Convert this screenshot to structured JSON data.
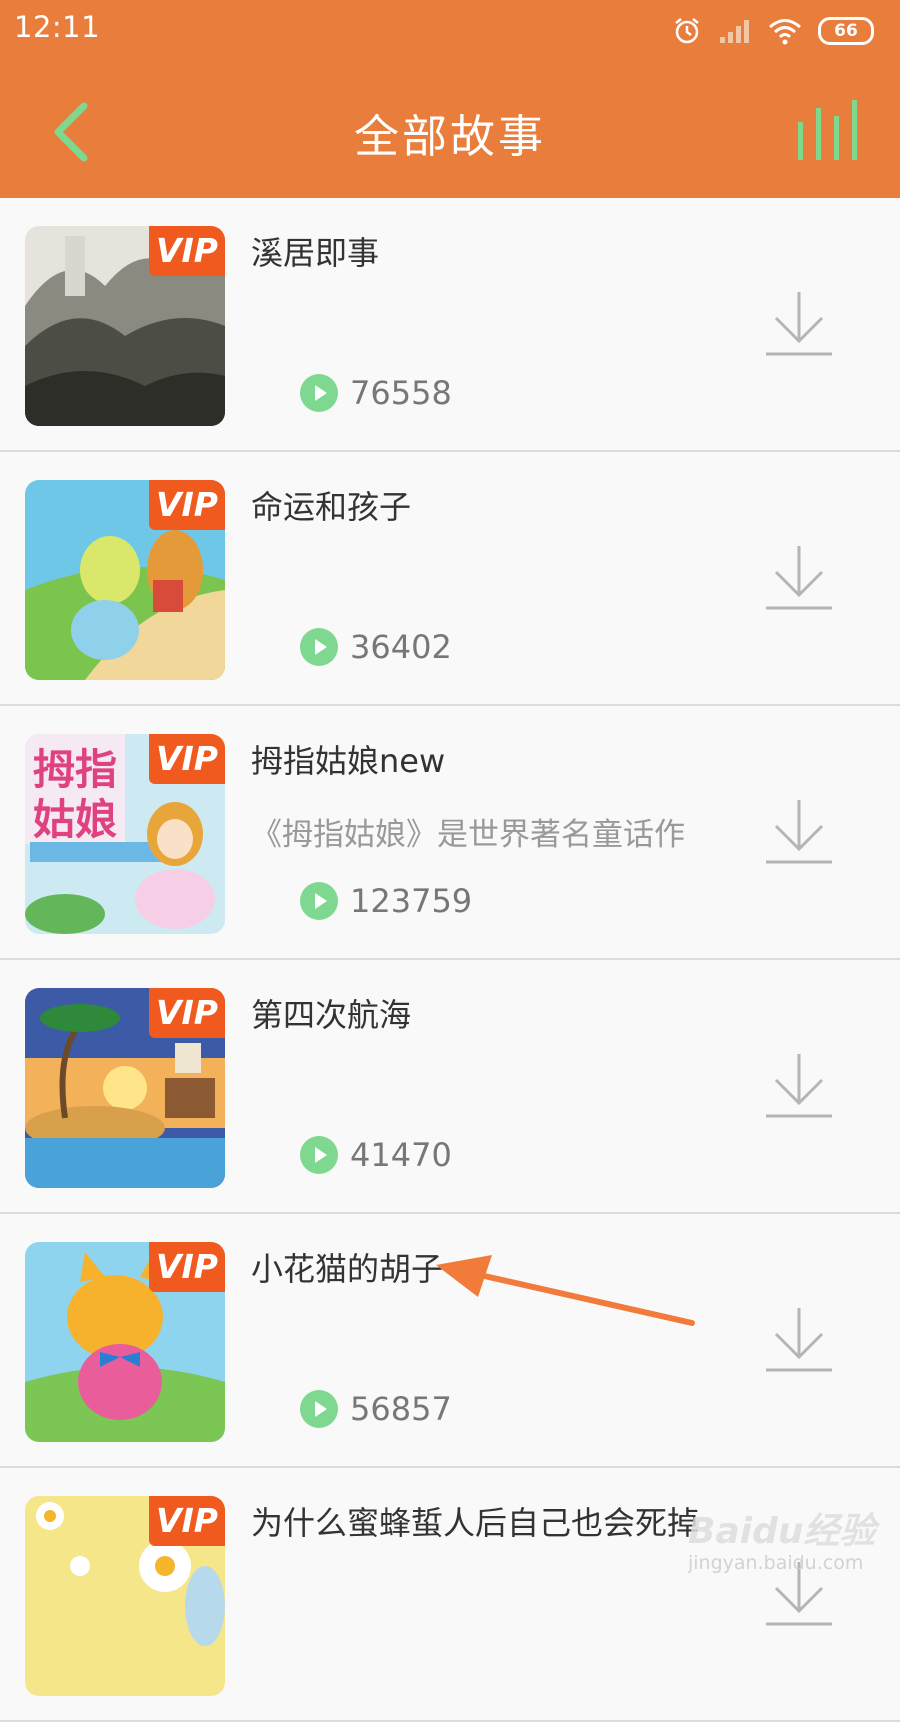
{
  "status_bar": {
    "time": "12:11",
    "battery": "66"
  },
  "header": {
    "title": "全部故事"
  },
  "colors": {
    "header_bg": "#e97d3c",
    "accent_green": "#7ed88f",
    "vip_bg": "#f05a1e"
  },
  "items": [
    {
      "title": "溪居即事",
      "description": "",
      "plays": "76558",
      "badge": "VIP"
    },
    {
      "title": "命运和孩子",
      "description": "",
      "plays": "36402",
      "badge": "VIP"
    },
    {
      "title": "拇指姑娘new",
      "description": "《拇指姑娘》是世界著名童话作",
      "plays": "123759",
      "badge": "VIP"
    },
    {
      "title": "第四次航海",
      "description": "",
      "plays": "41470",
      "badge": "VIP"
    },
    {
      "title": "小花猫的胡子",
      "description": "",
      "plays": "56857",
      "badge": "VIP"
    },
    {
      "title": "为什么蜜蜂蜇人后自己也会死掉",
      "description": "",
      "plays": "",
      "badge": "VIP"
    }
  ],
  "watermark": {
    "brand": "Baidu经验",
    "url": "jingyan.baidu.com"
  }
}
